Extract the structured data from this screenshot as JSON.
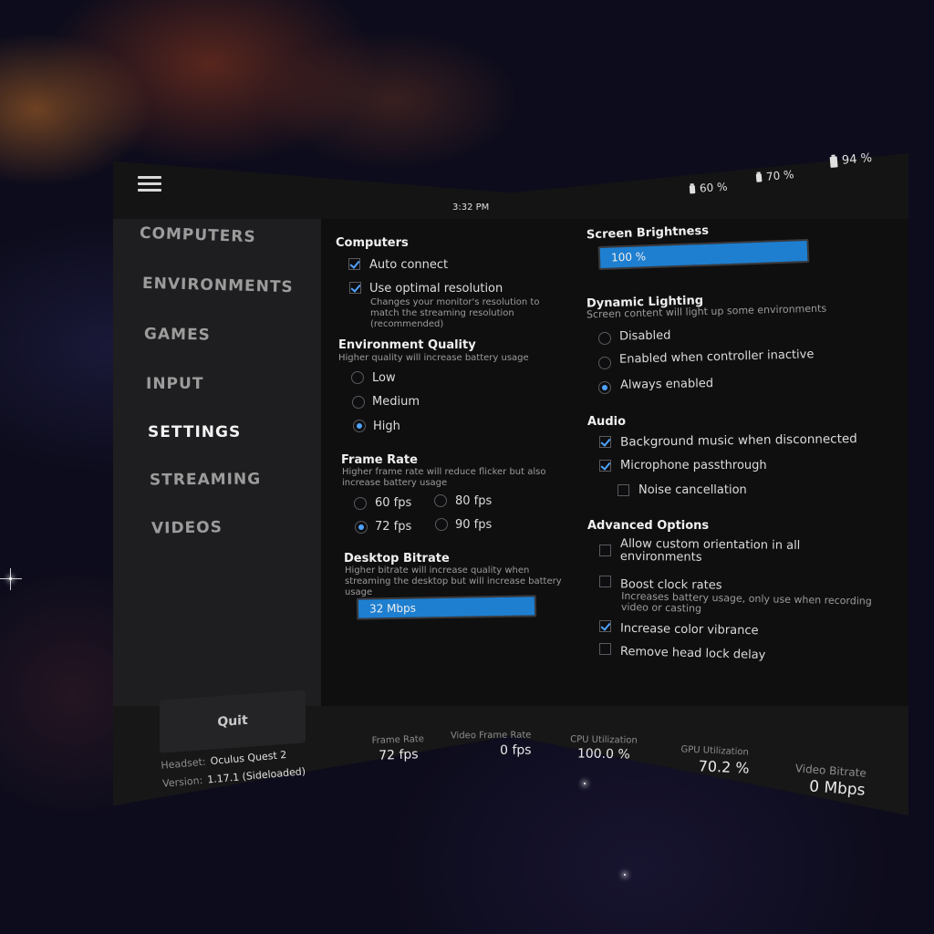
{
  "header": {
    "time": "3:32 PM",
    "batteries": [
      {
        "icon": "controller-battery-icon",
        "value": "60 %"
      },
      {
        "icon": "controller-battery-icon",
        "value": "70 %"
      },
      {
        "icon": "headset-battery-icon",
        "value": "94 %"
      }
    ]
  },
  "sidebar": {
    "items": [
      {
        "label": "COMPUTERS"
      },
      {
        "label": "ENVIRONMENTS"
      },
      {
        "label": "GAMES"
      },
      {
        "label": "INPUT"
      },
      {
        "label": "SETTINGS"
      },
      {
        "label": "STREAMING"
      },
      {
        "label": "VIDEOS"
      }
    ],
    "active": "SETTINGS",
    "quit_label": "Quit"
  },
  "settings": {
    "computers": {
      "title": "Computers",
      "auto_connect": {
        "label": "Auto connect",
        "checked": true
      },
      "optimal_resolution": {
        "label": "Use optimal resolution",
        "checked": true,
        "desc": "Changes your monitor's resolution to match the streaming resolution (recommended)"
      }
    },
    "environment_quality": {
      "title": "Environment Quality",
      "desc": "Higher quality will increase battery usage",
      "options": [
        "Low",
        "Medium",
        "High"
      ],
      "selected": "High"
    },
    "frame_rate": {
      "title": "Frame Rate",
      "desc": "Higher frame rate will reduce flicker but also increase battery usage",
      "options": [
        "60 fps",
        "80 fps",
        "72 fps",
        "90 fps"
      ],
      "selected": "72 fps"
    },
    "desktop_bitrate": {
      "title": "Desktop Bitrate",
      "desc": "Higher bitrate will increase quality when streaming the desktop but will increase battery usage",
      "value": "32 Mbps",
      "fill_fraction": 1.0
    },
    "screen_brightness": {
      "title": "Screen Brightness",
      "value": "100 %",
      "fill_fraction": 1.0
    },
    "dynamic_lighting": {
      "title": "Dynamic Lighting",
      "desc": "Screen content will light up some environments",
      "options": [
        "Disabled",
        "Enabled when controller inactive",
        "Always enabled"
      ],
      "selected": "Always enabled"
    },
    "audio": {
      "title": "Audio",
      "background_music": {
        "label": "Background music when disconnected",
        "checked": true
      },
      "microphone": {
        "label": "Microphone passthrough",
        "checked": true
      },
      "noise_cancellation": {
        "label": "Noise cancellation",
        "checked": false
      }
    },
    "advanced": {
      "title": "Advanced Options",
      "custom_orientation": {
        "label": "Allow custom orientation in all environments",
        "checked": false
      },
      "boost_clock": {
        "label": "Boost clock rates",
        "checked": false,
        "desc": "Increases battery usage, only use when recording video or casting"
      },
      "color_vibrance": {
        "label": "Increase color vibrance",
        "checked": true
      },
      "head_lock": {
        "label": "Remove head lock delay",
        "checked": false
      }
    }
  },
  "footer": {
    "headset_label": "Headset:",
    "headset_value": "Oculus Quest 2",
    "version_label": "Version:",
    "version_value": "1.17.1 (Sideloaded)",
    "stats": [
      {
        "label": "Frame Rate",
        "value": "72 fps"
      },
      {
        "label": "Video Frame Rate",
        "value": "0 fps"
      },
      {
        "label": "CPU Utilization",
        "value": "100.0 %"
      },
      {
        "label": "GPU Utilization",
        "value": "70.2 %"
      },
      {
        "label": "Video Bitrate",
        "value": "0 Mbps"
      }
    ]
  }
}
